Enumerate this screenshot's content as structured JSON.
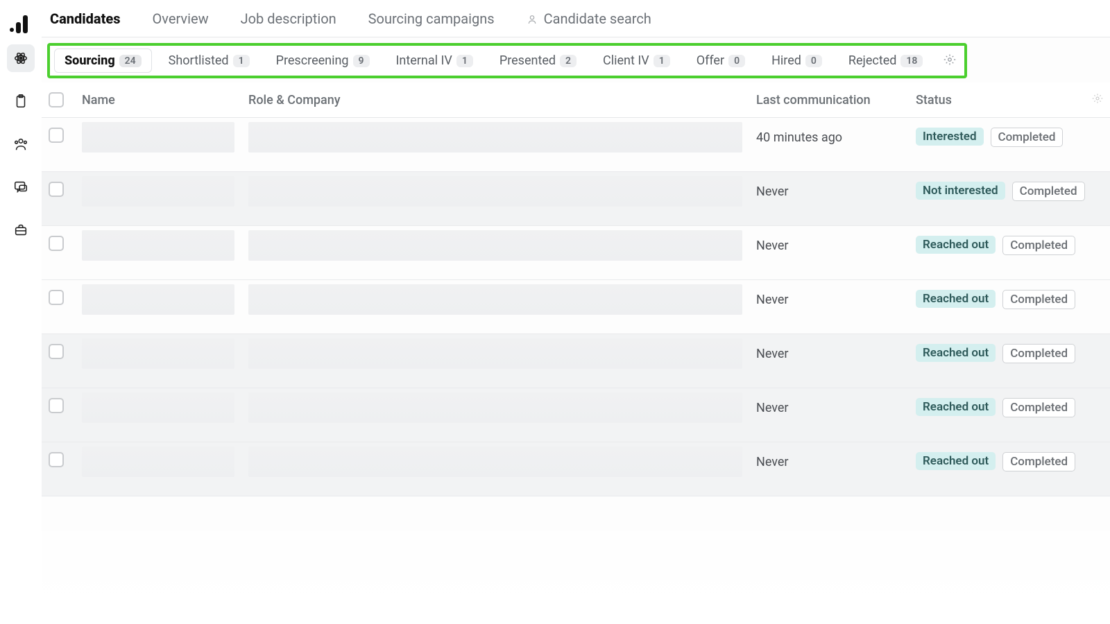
{
  "topnav": {
    "tabs": [
      {
        "label": "Candidates",
        "active": true
      },
      {
        "label": "Overview"
      },
      {
        "label": "Job description"
      },
      {
        "label": "Sourcing campaigns"
      },
      {
        "label": "Candidate search",
        "icon": "person"
      }
    ]
  },
  "stages": [
    {
      "label": "Sourcing",
      "count": "24",
      "active": true
    },
    {
      "label": "Shortlisted",
      "count": "1"
    },
    {
      "label": "Prescreening",
      "count": "9"
    },
    {
      "label": "Internal IV",
      "count": "1"
    },
    {
      "label": "Presented",
      "count": "2"
    },
    {
      "label": "Client IV",
      "count": "1"
    },
    {
      "label": "Offer",
      "count": "0"
    },
    {
      "label": "Hired",
      "count": "0"
    },
    {
      "label": "Rejected",
      "count": "18"
    }
  ],
  "columns": {
    "name": "Name",
    "role": "Role & Company",
    "last": "Last communication",
    "status": "Status"
  },
  "rows": [
    {
      "last": "40 minutes ago",
      "status1": "Interested",
      "status2": "Completed",
      "alt": false
    },
    {
      "last": "Never",
      "status1": "Not interested",
      "status2": "Completed",
      "alt": true
    },
    {
      "last": "Never",
      "status1": "Reached out",
      "status2": "Completed",
      "alt": false
    },
    {
      "last": "Never",
      "status1": "Reached out",
      "status2": "Completed",
      "alt": false
    },
    {
      "last": "Never",
      "status1": "Reached out",
      "status2": "Completed",
      "alt": true
    },
    {
      "last": "Never",
      "status1": "Reached out",
      "status2": "Completed",
      "alt": true
    },
    {
      "last": "Never",
      "status1": "Reached out",
      "status2": "Completed",
      "alt": true
    }
  ]
}
